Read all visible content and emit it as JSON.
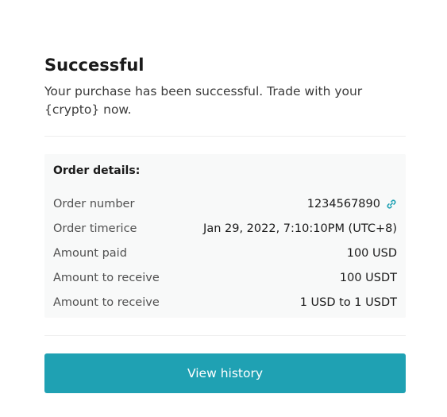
{
  "header": {
    "title": "Successful",
    "message": "Your purchase has been successful. Trade with your {crypto} now."
  },
  "order_details": {
    "title": "Order details:",
    "rows": [
      {
        "label": "Order number",
        "value": "1234567890",
        "has_copy_icon": true
      },
      {
        "label": "Order timerice",
        "value": "Jan 29, 2022, 7:10:10PM (UTC+8)"
      },
      {
        "label": "Amount paid",
        "value": "100 USD"
      },
      {
        "label": "Amount to receive",
        "value": "100 USDT"
      },
      {
        "label": "Amount to receive",
        "value": "1 USD to 1 USDT"
      }
    ]
  },
  "actions": {
    "view_history_label": "View history"
  },
  "icons": {
    "copy": "link-copy-icon"
  },
  "colors": {
    "accent": "#1fa1b3",
    "details_background": "#f8f9f9"
  }
}
